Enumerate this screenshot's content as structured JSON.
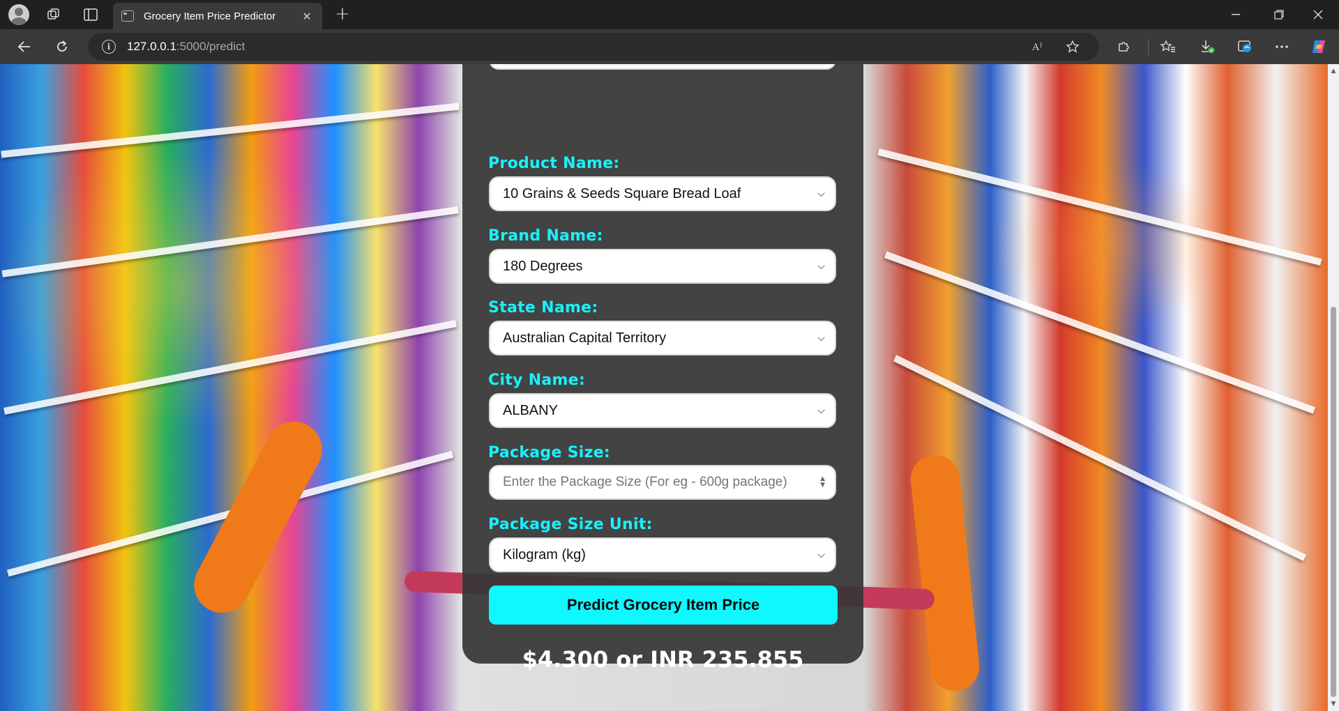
{
  "browser": {
    "tab_title": "Grocery Item Price Predictor",
    "url_host": "127.0.0.1",
    "url_path": ":5000/predict",
    "read_aloud_glyph": "A⁾"
  },
  "form": {
    "product": {
      "label": "Product Name:",
      "value": "10 Grains & Seeds Square Bread Loaf"
    },
    "brand": {
      "label": "Brand Name:",
      "value": "180 Degrees"
    },
    "state": {
      "label": "State Name:",
      "value": "Australian Capital Territory"
    },
    "city": {
      "label": "City Name:",
      "value": "ALBANY"
    },
    "package_size": {
      "label": "Package Size:",
      "placeholder": "Enter the Package Size (For eg - 600g package)"
    },
    "package_unit": {
      "label": "Package Size Unit:",
      "value": "Kilogram (kg)"
    },
    "submit_label": "Predict Grocery Item Price",
    "result": "$4.300 or INR 235.855"
  },
  "colors": {
    "label": "#17f2ff",
    "button": "#0ff7ff",
    "panel": "#373737"
  }
}
